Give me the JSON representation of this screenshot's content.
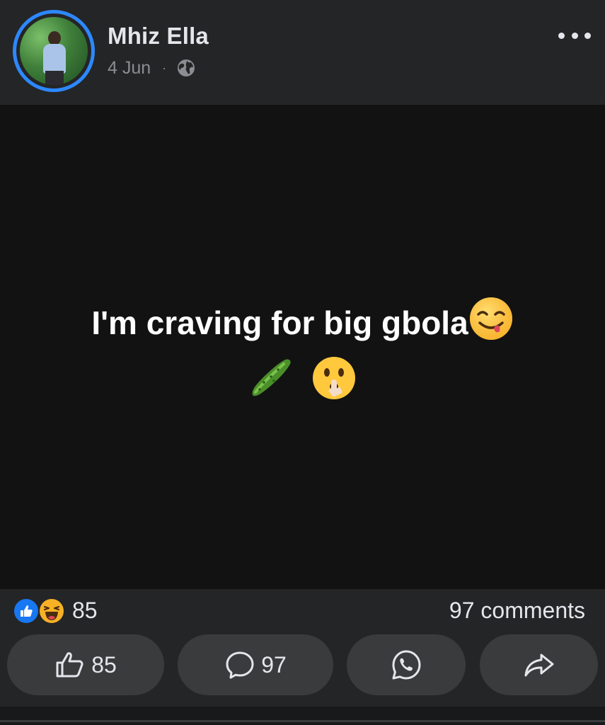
{
  "post": {
    "author": {
      "name": "Mhiz Ella"
    },
    "date": "4 Jun",
    "separator": "·",
    "privacy_icon": "globe-icon",
    "text_line1": "I'm craving for big gbola",
    "text_line2": "",
    "emojis": [
      "face-savoring-food",
      "cucumber",
      "shushing-face"
    ]
  },
  "reactions": {
    "icons": [
      "like-icon",
      "haha-icon"
    ],
    "count": "85",
    "comments_label": "97 comments"
  },
  "actions": {
    "like_count": "85",
    "comment_count": "97",
    "whatsapp_icon": "whatsapp-icon",
    "share_icon": "share-arrow-icon"
  },
  "colors": {
    "background": "#242526",
    "post_background": "#121213",
    "button_background": "#3a3b3c",
    "avatar_ring": "#2d88ff",
    "like_blue": "#1877f2",
    "text_primary": "#e4e6eb",
    "text_secondary": "#8a8d91"
  }
}
